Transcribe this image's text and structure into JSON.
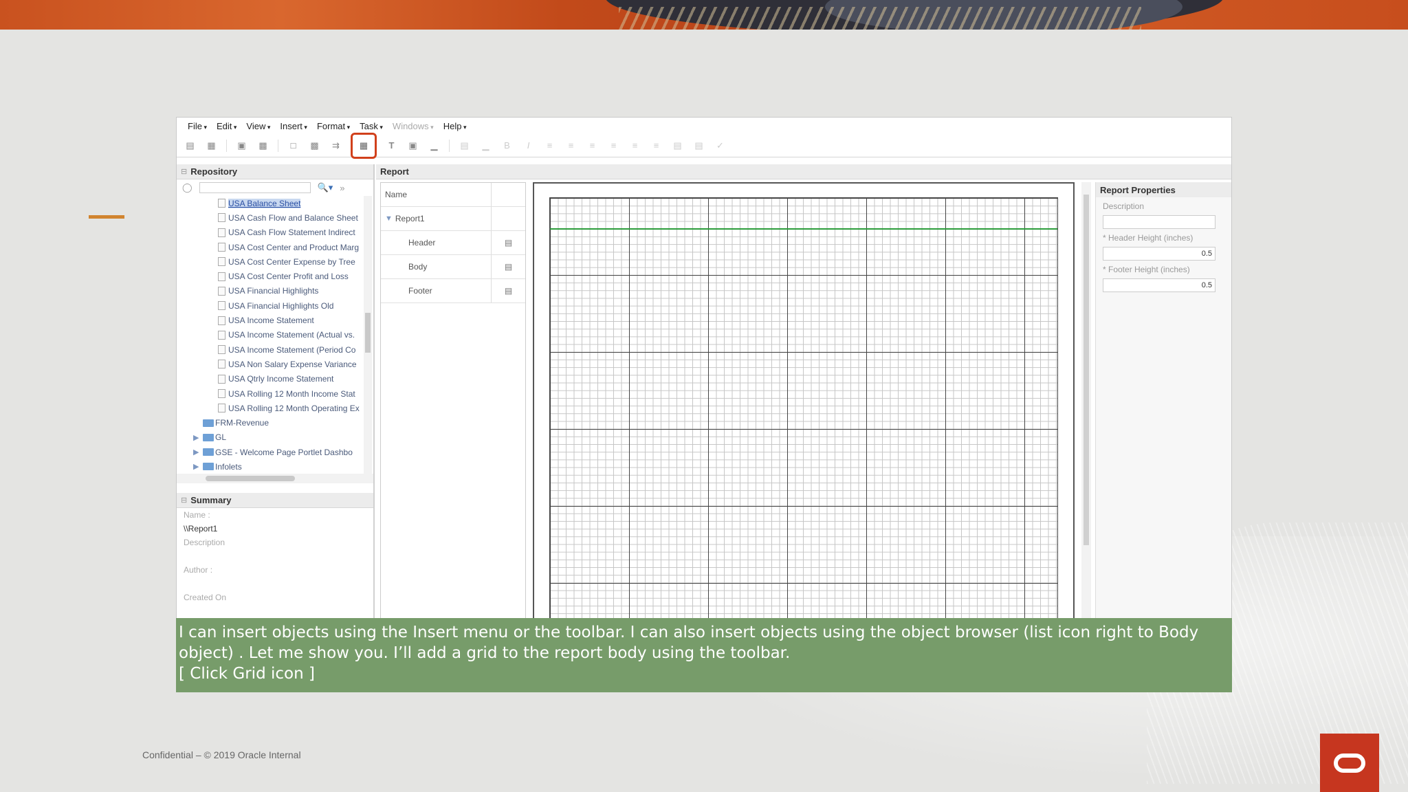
{
  "menu": [
    "File",
    "Edit",
    "View",
    "Insert",
    "Format",
    "Task",
    "Windows",
    "Help"
  ],
  "menu_disabled": [
    "Windows"
  ],
  "repository": {
    "title": "Repository",
    "items": [
      {
        "label": "USA Balance Sheet",
        "type": "doc",
        "selected": true
      },
      {
        "label": "USA Cash Flow and Balance Sheet",
        "type": "doc"
      },
      {
        "label": "USA Cash Flow Statement Indirect",
        "type": "doc"
      },
      {
        "label": "USA Cost Center and Product Marg",
        "type": "doc"
      },
      {
        "label": "USA Cost Center Expense by Tree",
        "type": "doc"
      },
      {
        "label": "USA Cost Center Profit and Loss",
        "type": "doc"
      },
      {
        "label": "USA Financial Highlights",
        "type": "doc"
      },
      {
        "label": "USA Financial Highlights Old",
        "type": "doc"
      },
      {
        "label": "USA Income Statement",
        "type": "doc"
      },
      {
        "label": "USA Income Statement (Actual vs.",
        "type": "doc"
      },
      {
        "label": "USA Income Statement (Period Co",
        "type": "doc"
      },
      {
        "label": "USA Non Salary Expense Variance",
        "type": "doc"
      },
      {
        "label": "USA Qtrly Income Statement",
        "type": "doc"
      },
      {
        "label": "USA Rolling 12 Month Income Stat",
        "type": "doc"
      },
      {
        "label": "USA Rolling 12 Month Operating Ex",
        "type": "doc"
      },
      {
        "label": "FRM-Revenue",
        "type": "folder"
      },
      {
        "label": "GL",
        "type": "folder",
        "expandable": true
      },
      {
        "label": "GSE - Welcome Page Portlet Dashbo",
        "type": "folder",
        "expandable": true
      },
      {
        "label": "Infolets",
        "type": "folder",
        "expandable": true
      }
    ]
  },
  "summary": {
    "title": "Summary",
    "name_label": "Name :",
    "name_value": "\\\\Report1",
    "description_label": "Description",
    "author_label": "Author :",
    "created_label": "Created On"
  },
  "report": {
    "title": "Report",
    "col_name": "Name",
    "root": "Report1",
    "sections": [
      "Header",
      "Body",
      "Footer"
    ]
  },
  "properties": {
    "title": "Report Properties",
    "description_label": "Description",
    "description_value": "",
    "header_label": "* Header Height (inches)",
    "header_value": "0.5",
    "footer_label": "* Footer Height (inches)",
    "footer_value": "0.5"
  },
  "caption": {
    "line1": "I can insert objects using the Insert menu or the toolbar. I can also insert objects using the object browser (list icon right to Body object) . Let me show you. I’ll add a grid to the report body using the toolbar.",
    "line2": "[ Click Grid icon ]"
  },
  "footer": "Confidential – © 2019 Oracle Internal",
  "colors": {
    "caption_bg": "#779c6a",
    "highlight": "#d1401b",
    "logo": "#c6361f",
    "accent": "#d1842f"
  }
}
